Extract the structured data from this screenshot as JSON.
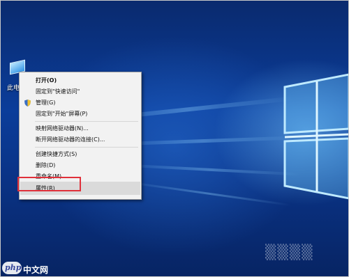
{
  "desktop": {
    "icon_label": "此电"
  },
  "context_menu": {
    "items": [
      {
        "label": "打开(O)",
        "bold": true
      },
      {
        "label": "固定到\"快速访问\""
      },
      {
        "label": "管理(G)",
        "icon": "shield-icon"
      },
      {
        "label": "固定到\"开始\"屏幕(P)"
      },
      {
        "label": "映射网络驱动器(N)..."
      },
      {
        "label": "断开网络驱动器的连接(C)..."
      },
      {
        "label": "创建快捷方式(S)"
      },
      {
        "label": "删除(D)"
      },
      {
        "label": "重命名(M)"
      },
      {
        "label": "属性(R)",
        "highlighted": true
      }
    ]
  },
  "annotation": {
    "color": "#e0303a"
  },
  "watermark": {
    "badge": "php",
    "site": "中文网"
  }
}
